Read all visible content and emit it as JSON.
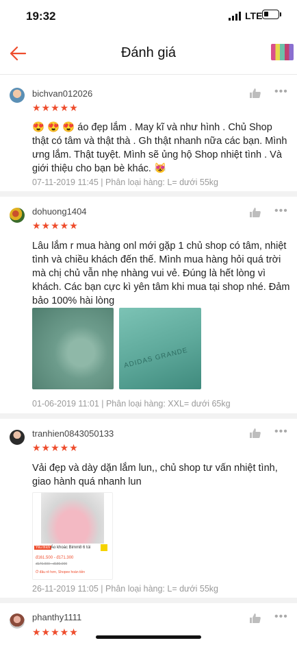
{
  "status_bar": {
    "time": "19:32",
    "network": "LTE"
  },
  "header": {
    "title": "Đánh giá"
  },
  "reviews": [
    {
      "username": "bichvan012026",
      "stars": "★★★★★",
      "rating": 5,
      "text": "😍 😍 😍 áo đẹp lắm . May kĩ và như hình . Chủ Shop thật có tâm và thật thà . Gh thật nhanh nữa các bạn. Mình ưng lắm. Thật tuyệt. Mình sẽ ủng hộ Shop nhiệt tình . Và giới thiệu cho bạn bè khác. 😻",
      "meta": "07-11-2019 11:45 | Phân loại hàng: L= dưới 55kg"
    },
    {
      "username": "dohuong1404",
      "stars": "★★★★★",
      "rating": 5,
      "text": "Lâu lắm r mua hàng onl mới gặp 1 chủ shop có tâm, nhiệt tình và chiều khách đến thế. Mình mua hàng hỏi quá trời mà chị chủ vẫn nhẹ nhàng vui vẻ. Đúng là hết lòng vì khách. Các bạn cực kì yên tâm khi mua tại shop nhé. Đảm bảo 100% hài lòng",
      "photo2_text": "ADIDAS GRANDE",
      "meta": "01-06-2019 11:01 | Phân loại hàng: XXL= dưới 65kg"
    },
    {
      "username": "tranhien0843050133",
      "stars": "★★★★★",
      "rating": 5,
      "text": "Vải đẹp và dày dặn lắm lun,, chủ shop tư vấn nhiệt tình, giao hành quá nhanh lun",
      "shot_badge": "Yêu thích",
      "shot_title": "Áo khoác Bimm8 6 túi",
      "shot_price": "đ161.500 - đ171.300",
      "shot_old_price": "đ170.000 - đ180.000",
      "shot_note": "Ở đâu rẻ hơn, Shopee hoàn tiền",
      "meta": "26-11-2019 11:05 | Phân loại hàng: L= dưới 55kg"
    },
    {
      "username": "phanthy1111",
      "stars": "★★★★★",
      "rating": 5
    }
  ],
  "colors": {
    "accent": "#ee4d2d",
    "meta": "#999999",
    "divider": "#f2f2f2"
  }
}
